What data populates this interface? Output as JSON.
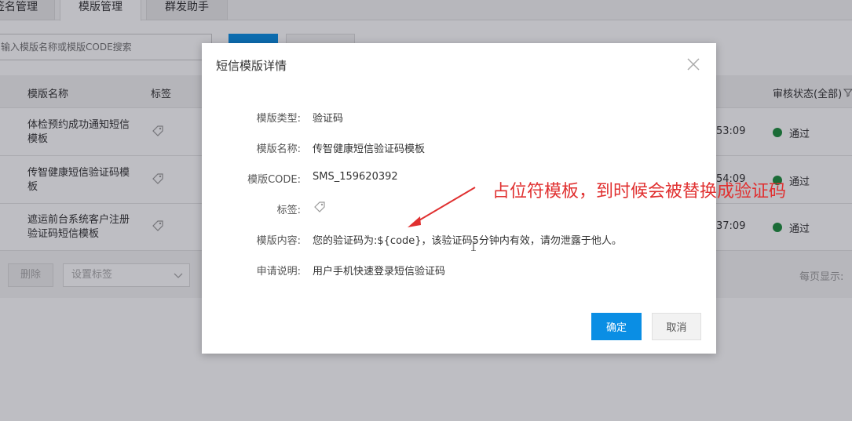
{
  "tabs": [
    "签名管理",
    "模版管理",
    "群发助手"
  ],
  "search": {
    "placeholder": "输入模版名称或模版CODE搜索"
  },
  "table": {
    "headers": {
      "name": "模版名称",
      "tag": "标签",
      "status": "审核状态(全部)"
    },
    "rows": [
      {
        "name": "体检预约成功通知短信模板",
        "time": "53:09",
        "status": "通过"
      },
      {
        "name": "传智健康短信验证码模板",
        "time": "54:09",
        "status": "通过"
      },
      {
        "name": "遮运前台系统客户注册验证码短信模板",
        "time": "37:09",
        "status": "通过"
      }
    ]
  },
  "toolbar": {
    "delete_label": "删除",
    "tag_select_placeholder": "设置标签",
    "per_page_label": "每页显示:"
  },
  "modal": {
    "title": "短信模版详情",
    "fields": [
      {
        "label": "模版类型:",
        "value": "验证码"
      },
      {
        "label": "模版名称:",
        "value": "传智健康短信验证码模板"
      },
      {
        "label": "模版CODE:",
        "value": "SMS_159620392"
      },
      {
        "label": "标签:",
        "value": ""
      },
      {
        "label": "模版内容:",
        "value": "您的验证码为:${code}，该验证码5分钟内有效，请勿泄露于他人。"
      },
      {
        "label": "申请说明:",
        "value": "用户手机快速登录短信验证码"
      }
    ],
    "ok_label": "确定",
    "cancel_label": "取消"
  },
  "annotation": {
    "text": "占位符模板，到时候会被替换成验证码",
    "color": "#e03030"
  },
  "colors": {
    "primary": "#0a8ee4",
    "success": "#1e8e3e"
  },
  "icons": [
    "tag-icon",
    "close-icon",
    "filter-icon",
    "chevron-down-icon"
  ]
}
